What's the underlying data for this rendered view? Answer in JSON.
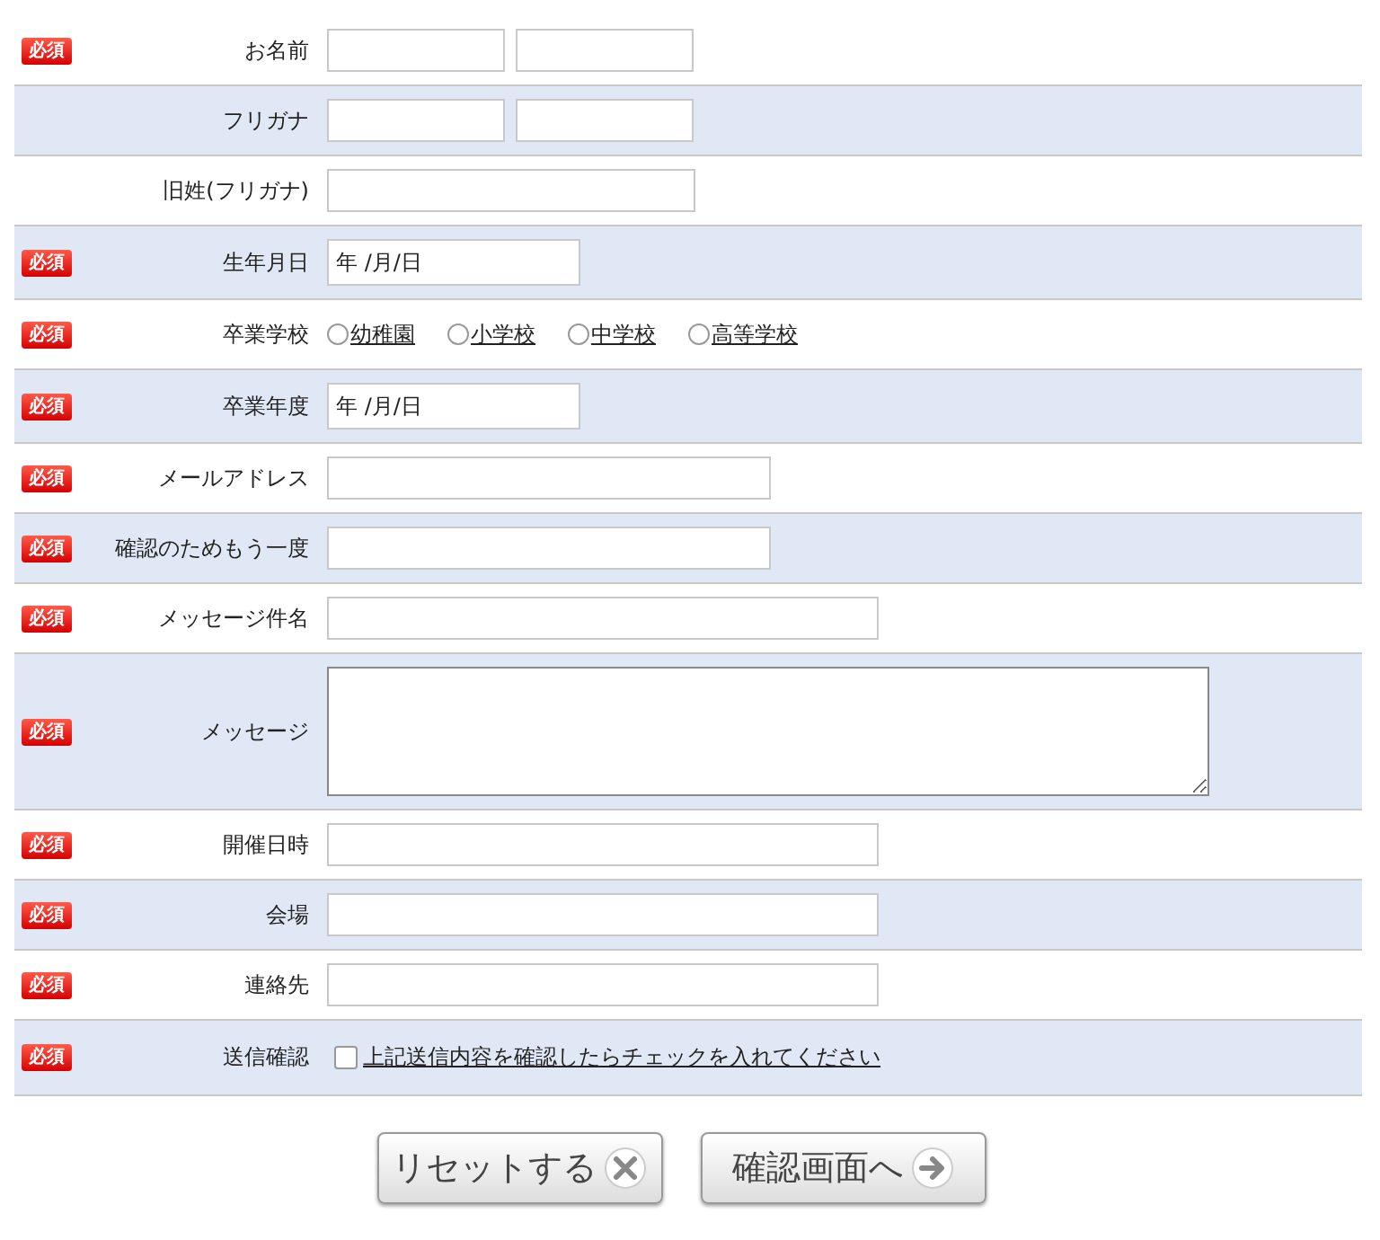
{
  "form": {
    "rows": [
      {
        "badge": "必須",
        "label": "お名前",
        "kind": "text-pair"
      },
      {
        "label": "フリガナ",
        "kind": "text-pair"
      },
      {
        "label": "旧姓(フリガナ)",
        "kind": "text-medium"
      },
      {
        "badge": "必須",
        "label": "生年月日",
        "kind": "date",
        "value": "年 /月/日"
      },
      {
        "badge": "必須",
        "label": "卒業学校",
        "kind": "radio",
        "options": [
          {
            "label": "幼稚園",
            "selected": false
          },
          {
            "label": "小学校",
            "selected": false
          },
          {
            "label": "中学校",
            "selected": false
          },
          {
            "label": "高等学校",
            "selected": false
          }
        ]
      },
      {
        "badge": "必須",
        "label": "卒業年度",
        "kind": "date",
        "value": "年 /月/日"
      },
      {
        "badge": "必須",
        "label": "メールアドレス",
        "kind": "text-wide"
      },
      {
        "badge": "必須",
        "label": "確認のためもう一度",
        "kind": "text-wide"
      },
      {
        "badge": "必須",
        "label": "メッセージ件名",
        "kind": "text-long"
      },
      {
        "badge": "必須",
        "label": "メッセージ",
        "kind": "textarea"
      },
      {
        "badge": "必須",
        "label": "開催日時",
        "kind": "text-long"
      },
      {
        "badge": "必須",
        "label": "会場",
        "kind": "text-long"
      },
      {
        "badge": "必須",
        "label": "連絡先",
        "kind": "text-long"
      },
      {
        "badge": "必須",
        "label": "送信確認",
        "kind": "checkbox",
        "checked": false,
        "text": "上記送信内容を確認したらチェックを入れてください"
      }
    ]
  },
  "buttons": [
    {
      "label": "リセットする",
      "kind": "reset"
    },
    {
      "label": "確認画面へ",
      "kind": "next"
    }
  ]
}
